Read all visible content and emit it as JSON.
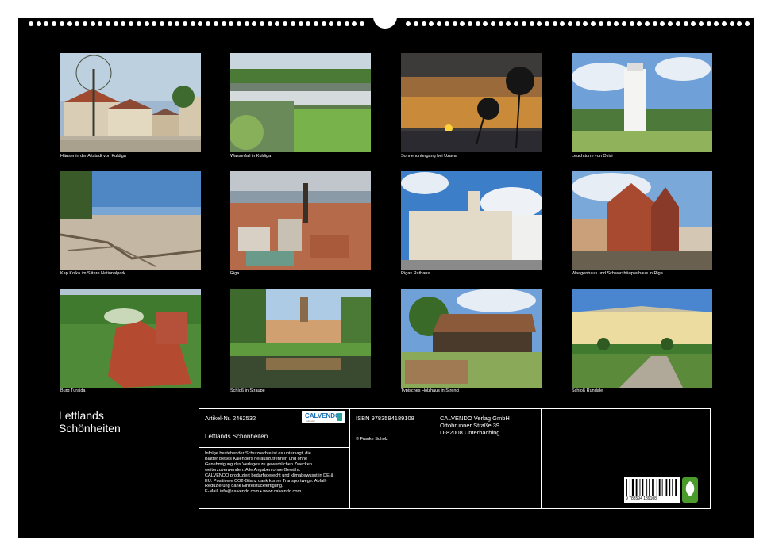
{
  "photos": [
    {
      "caption": "Häuser in der Altstadt von Kuldiga"
    },
    {
      "caption": "Wasserfall in Kuldiga"
    },
    {
      "caption": "Sonnenuntergang bei Uzava"
    },
    {
      "caption": "Leuchtturm von Ovisi"
    },
    {
      "caption": "Kap Kolka im Slitere Nationalpark"
    },
    {
      "caption": "Riga"
    },
    {
      "caption": "Rigas Rathaus"
    },
    {
      "caption": "Waagenhaus und Schwarzhäupterhaus in Riga"
    },
    {
      "caption": "Burg Turaida"
    },
    {
      "caption": "Schloß in Straupe"
    },
    {
      "caption": "Typisches Holzhaus in Strenci"
    },
    {
      "caption": "Schloß Rundale"
    }
  ],
  "title_line1": "Lettlands",
  "title_line2": "Schönheiten",
  "info": {
    "article_no": "Artikel-Nr. 2462532",
    "logo_text": "CALVENDO",
    "logo_sub": "Kalender",
    "product_title": "Lettlands Schönheiten",
    "legal_text": [
      "Infolge bestehender Schutzrechte ist es untersagt, die",
      "Blätter dieses Kalenders herauszutrennen und ohne",
      "Genehmigung des Verlages zu gewerblichen Zwecken",
      "weiterzuverwenden. Alle Angaben ohne Gewähr.",
      "CALVENDO produziert bedarfsgerecht und klimabewusst in DE &",
      "EU. Positivere CO2-Bilanz dank kurzer Transportwege. Abfall-",
      "Reduzierung dank Einzelstückfertigung.",
      "E-Mail: info@calvendo.com • www.calvendo.com"
    ],
    "isbn": "ISBN 9783594189108",
    "copyright": "© Frauke Scholz",
    "publisher_lines": [
      "CALVENDO Verlag GmbH",
      "Ottobrunner Straße 39",
      "D-82008 Unterhaching"
    ],
    "barcode_number": "9 783594 189108"
  }
}
